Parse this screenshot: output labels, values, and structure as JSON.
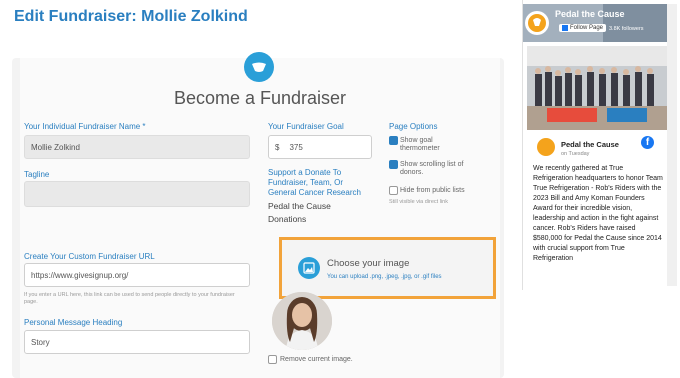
{
  "page_title": "Edit Fundraiser: Mollie Zolkind",
  "form": {
    "heading": "Become a Fundraiser",
    "name_label": "Your Individual Fundraiser Name *",
    "name_value": "Mollie Zolkind",
    "goal_label": "Your Fundraiser Goal",
    "goal_currency": "$",
    "goal_value": "375",
    "tagline_label": "Tagline",
    "tagline_value": "",
    "support_label": "Support a Donate To Fundraiser, Team, Or General Cancer Research",
    "support_value": "Pedal the Cause Donations",
    "page_options_label": "Page Options",
    "options": [
      {
        "label": "Show goal thermometer",
        "checked": true
      },
      {
        "label": "Show scrolling list of donors.",
        "checked": true
      },
      {
        "label": "Hide from public lists",
        "checked": false
      }
    ],
    "hide_note": "Still visible via direct link",
    "url_label": "Create Your Custom Fundraiser URL",
    "url_value": "https://www.givesignup.org/",
    "url_help": "If you enter a URL here, this link can be used to send people directly to your fundraiser page.",
    "message_heading_label": "Personal Message Heading",
    "message_heading_value": "Story",
    "upload_title": "Choose your image",
    "upload_sub": "You can upload .png, .jpeg, .jpg, or .gif files",
    "remove_image_label": "Remove current image."
  },
  "facebook": {
    "page_name": "Pedal the Cause",
    "follow_label": "Follow Page",
    "followers": "3.8K followers",
    "post_author": "Pedal the Cause",
    "post_time": "on Tuesday",
    "post_text": "We recently gathered at True Refrigeration headquarters to honor Team True Refrigeration - Rob's Riders with the 2023 Bill and Amy Koman Founders Award for their incredible vision, leadership and action in the fight against cancer. Rob's Riders have raised $580,000 for Pedal the Cause since 2014 with crucial support from True Refrigeration"
  },
  "colors": {
    "accent": "#2a7fc0",
    "highlight": "#f2a33a",
    "facebook": "#1877f2"
  }
}
